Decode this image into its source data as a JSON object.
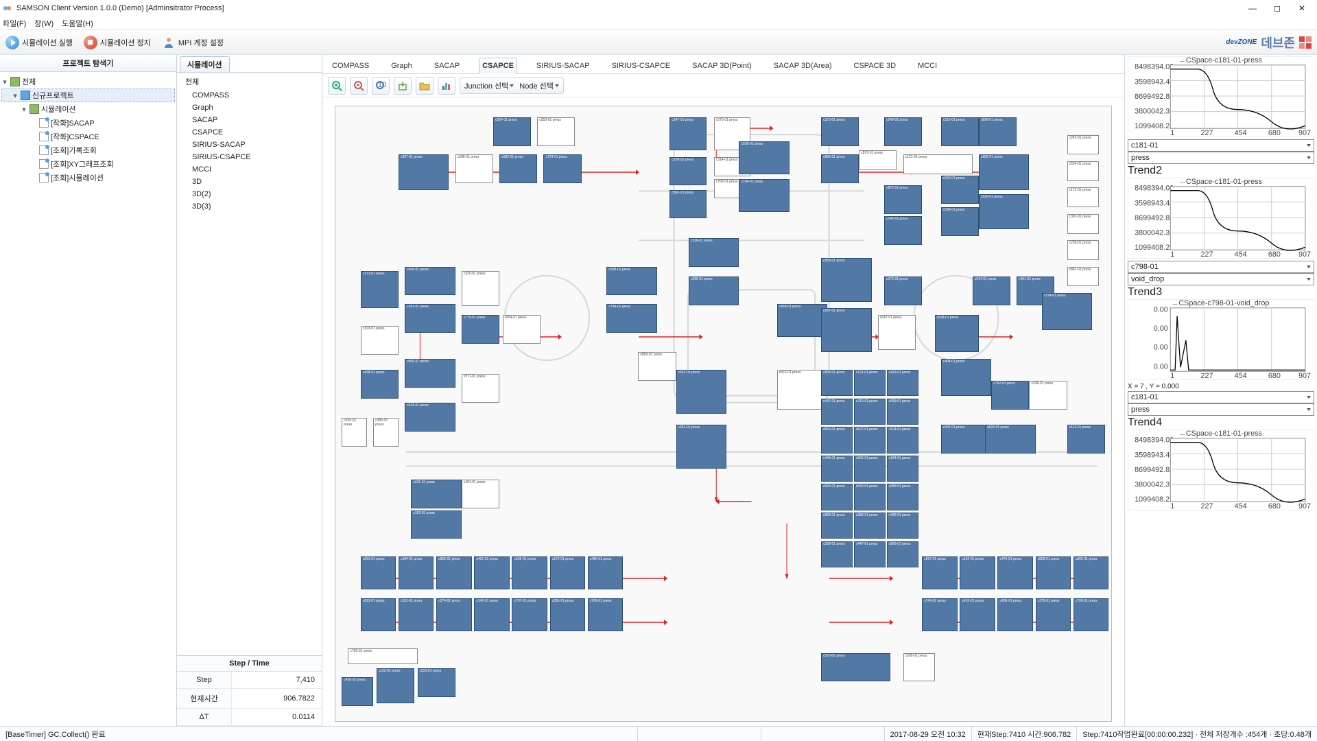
{
  "window": {
    "title": "SAMSON Client Version 1.0.0 (Demo) [Adminsitrator Process]"
  },
  "menu": {
    "file": "파일(F)",
    "window": "창(W)",
    "help": "도움말(H)"
  },
  "toolbar": {
    "run": "시뮬레이션 실행",
    "stop": "시뮬레이션 정지",
    "mpi": "MPI 계정 설정",
    "brand_dev": "devZONE",
    "brand_kr": "데브존"
  },
  "left_panel": {
    "title": "프로젝트 탐색기",
    "root": "전체",
    "project": "신규프로젝트",
    "simulation": "시뮬레이션",
    "items": [
      {
        "label": "[작화]SACAP"
      },
      {
        "label": "[작화]CSPACE"
      },
      {
        "label": "[조회]기록조회"
      },
      {
        "label": "[조회]XY그래프조회"
      },
      {
        "label": "[조회]시뮬레이션"
      }
    ]
  },
  "mid_panel": {
    "tab": "시뮬레이션",
    "list": [
      "전체",
      "COMPASS",
      "Graph",
      "SACAP",
      "CSAPCE",
      "SIRIUS-SACAP",
      "SIRIUS-CSAPCE",
      "MCCI",
      "3D",
      "3D(2)",
      "3D(3)"
    ],
    "steptime_hdr": "Step / Time",
    "rows": [
      {
        "lbl": "Step",
        "val": "7,410"
      },
      {
        "lbl": "현재시간",
        "val": "906.7822"
      },
      {
        "lbl": "ΔT",
        "val": "0.0114"
      }
    ]
  },
  "center": {
    "tabs": [
      "COMPASS",
      "Graph",
      "SACAP",
      "CSAPCE",
      "SIRIUS-SACAP",
      "SIRIUS-CSAPCE",
      "SACAP 3D(Point)",
      "SACAP 3D(Area)",
      "CSPACE 3D",
      "MCCI"
    ],
    "active_idx": 3,
    "sel_junction": "Junction 선택",
    "sel_node": "Node 선택"
  },
  "trends": {
    "t1_legend": "CSpace-c181-01-press",
    "yticks": [
      "8498394.00",
      "3598943.44",
      "8699492.88",
      "3800042.31",
      "1099408.25"
    ],
    "xticks": [
      "1",
      "227",
      "454",
      "680",
      "907"
    ],
    "dd1a": "c181-01",
    "dd1b": "press",
    "h2": "Trend2",
    "t2_legend": "CSpace-c181-01-press",
    "dd2a": "c798-01",
    "dd2b": "void_drop",
    "h3": "Trend3",
    "t3_legend": "CSpace-c798-01-void_drop",
    "t3_yticks": [
      "0.00",
      "0.00",
      "0.00",
      "0.00"
    ],
    "coord": "X = 7 , Y = 0.000",
    "dd3a": "c181-01",
    "dd3b": "press",
    "h4": "Trend4",
    "t4_legend": "CSpace-c181-01-press"
  },
  "chart_data": [
    {
      "type": "line",
      "title": "CSpace-c181-01-press",
      "x": [
        1,
        50,
        120,
        220,
        454,
        680,
        907
      ],
      "y": [
        8498394,
        8498394,
        5500000,
        3598943,
        2800000,
        1500000,
        1099408
      ],
      "xlim": [
        1,
        907
      ],
      "ylim": [
        1099408,
        8498394
      ]
    },
    {
      "type": "line",
      "title": "CSpace-c181-01-press",
      "x": [
        1,
        50,
        120,
        220,
        454,
        680,
        907
      ],
      "y": [
        8498394,
        8498394,
        5500000,
        3598943,
        2800000,
        1500000,
        1099408
      ],
      "xlim": [
        1,
        907
      ],
      "ylim": [
        1099408,
        8498394
      ]
    },
    {
      "type": "line",
      "title": "CSpace-c798-01-void_drop",
      "x": [
        1,
        30,
        40,
        60,
        80,
        907
      ],
      "y": [
        0,
        0.02,
        0.6,
        0.05,
        0,
        0
      ],
      "xlim": [
        1,
        907
      ],
      "ylim": [
        0,
        1
      ]
    },
    {
      "type": "line",
      "title": "CSpace-c181-01-press",
      "x": [
        1,
        50,
        120,
        220,
        454,
        680,
        907
      ],
      "y": [
        8498394,
        8498394,
        5500000,
        3598943,
        2800000,
        1500000,
        1099408
      ],
      "xlim": [
        1,
        907
      ],
      "ylim": [
        1099408,
        8498394
      ]
    }
  ],
  "status": {
    "left": "[BaseTimer] GC.Collect() 완료",
    "time": "2017-08-29 오전 10:32",
    "step": "현재Step:7410 시간:906.782",
    "detail": "Step:7410작업완료[00:00:00.232] · 전체 저장개수 :454개 · 초당:0.48개"
  }
}
